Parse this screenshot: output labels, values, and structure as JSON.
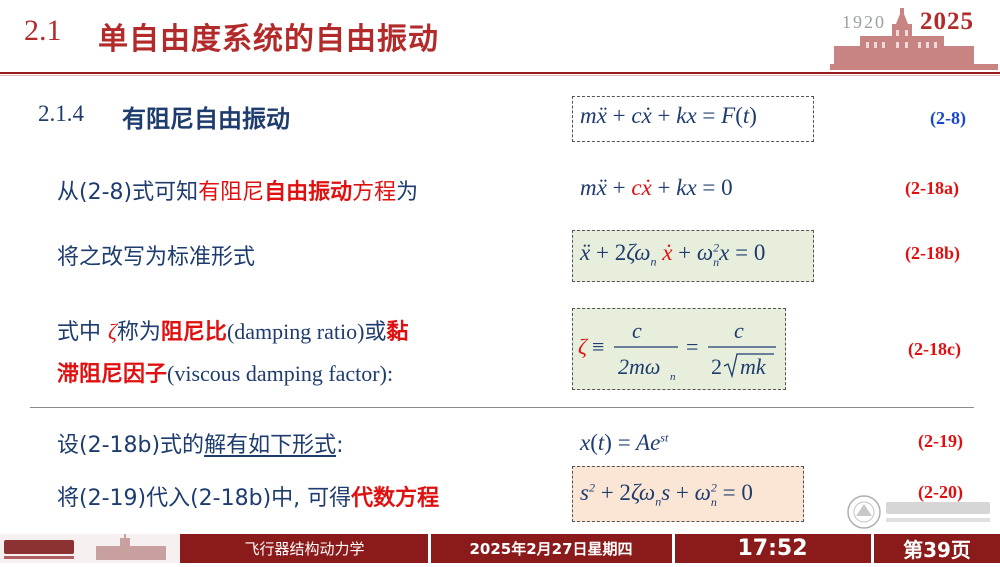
{
  "header": {
    "section_number": "2.1",
    "title": "单自由度系统的自由振动",
    "anniversary": {
      "year_start": "1920",
      "year_end": "2025"
    }
  },
  "section": {
    "number": "2.1.4",
    "title": "有阻尼自由振动"
  },
  "lines": {
    "l1": {
      "pre": "从(2-8)式可知",
      "red1": "有阻尼",
      "redb": "自由振动",
      "red2": "方程",
      "post": "为"
    },
    "l2": {
      "text": "将之改写为标准形式"
    },
    "l3": {
      "pre": "式中 ",
      "zeta": "ζ",
      "mid": "称为",
      "redb1": "阻尼比",
      "paren": "(damping ratio)",
      "or": "或",
      "redb2": "黏"
    },
    "l4": {
      "redb": "滞阻尼因子",
      "paren": "(viscous damping factor):"
    },
    "l5": {
      "pre": "设(2-18b)式的",
      "link": "解有如下形式",
      "post": ":"
    },
    "l6": {
      "pre": "将(2-19)代入(2-18b)中, 可得",
      "redb": "代数方程"
    }
  },
  "tags": {
    "t1": "(2-8)",
    "t2": "(2-18a)",
    "t3": "(2-18b)",
    "t4": "(2-18c)",
    "t5": "(2-19)",
    "t6": "(2-20)"
  },
  "colors": {
    "title_red": "#b22a2a",
    "text_navy": "#1e3c6e",
    "emphasis_red": "#e01010",
    "tag_blue": "#1a47c8",
    "box_green": "#e8eedc",
    "box_orange": "#fbe6d6",
    "footer_red": "#8b1a1a"
  },
  "footer": {
    "course": "飞行器结构动力学",
    "date": "2025年2月27日星期四",
    "time": "17:52",
    "page": "第39页"
  }
}
